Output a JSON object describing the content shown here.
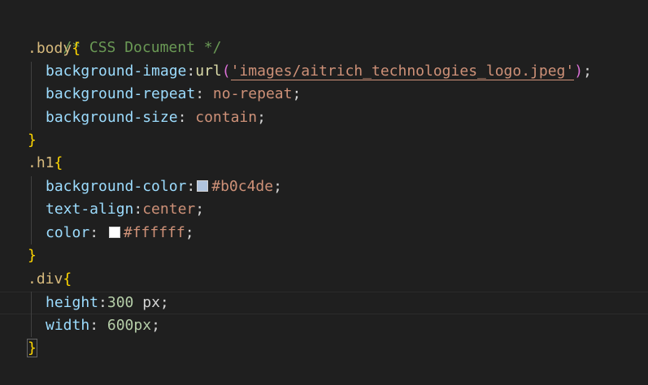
{
  "editor": {
    "language": "css",
    "colors": {
      "background": "#1f1f1f",
      "comment": "#6a9955",
      "selector": "#d7ba7d",
      "brace": "#ffd700",
      "brace_nested": "#da70d6",
      "property": "#9cdcfe",
      "value": "#ce9178",
      "number": "#b5cea8",
      "function": "#dcdcaa"
    },
    "lines": {
      "l1": {
        "comment": "/* CSS Document */"
      },
      "l2": {
        "selector": ".body",
        "brace": "{"
      },
      "l3": {
        "prop": "background-image",
        "colon": ":",
        "func": "url",
        "open": "(",
        "str": "'images/aitrich_technologies_logo.jpeg'",
        "close": ")",
        "semi": ";"
      },
      "l4": {
        "prop": "background-repeat",
        "colon": ": ",
        "val": "no-repeat",
        "semi": ";"
      },
      "l5": {
        "prop": "background-size",
        "colon": ": ",
        "val": "contain",
        "semi": ";"
      },
      "l6": {
        "brace": "}"
      },
      "l7": {
        "selector": ".h1",
        "brace": "{"
      },
      "l8": {
        "prop": "background-color",
        "colon": ":",
        "swatch": "#b0c4de",
        "val": "#b0c4de",
        "semi": ";"
      },
      "l9": {
        "prop": "text-align",
        "colon": ":",
        "val": "center",
        "semi": ";"
      },
      "l10": {
        "prop": "color",
        "colon": ": ",
        "swatch": "#ffffff",
        "val": "#ffffff",
        "semi": ";"
      },
      "l11": {
        "brace": "}"
      },
      "l12": {
        "selector": ".div",
        "brace": "{"
      },
      "l13": {
        "prop": "height",
        "colon": ":",
        "num": "300",
        "unit": " px",
        "semi": ";"
      },
      "l14": {
        "prop": "width",
        "colon": ": ",
        "num": "600px",
        "semi": ";"
      },
      "l15": {
        "brace": "}"
      }
    }
  }
}
